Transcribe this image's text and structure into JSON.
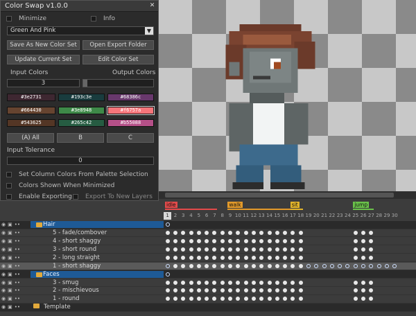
{
  "panel": {
    "title": "Color Swap v1.0.0",
    "minimize_label": "Minimize",
    "info_label": "Info",
    "preset_selected": "Green And Pink",
    "buttons": {
      "save_new": "Save As New Color Set",
      "open_export": "Open Export Folder",
      "update_current": "Update Current Set",
      "edit_color": "Edit Color Set"
    },
    "input_colors_label": "Input Colors",
    "output_colors_label": "Output Colors",
    "input_colors_value": "3",
    "swatches": [
      [
        {
          "hex": "#3e2731",
          "color": "#3e2731"
        },
        {
          "hex": "#193c3e",
          "color": "#193c3e"
        },
        {
          "hex": "#68386c",
          "color": "#68386c"
        }
      ],
      [
        {
          "hex": "#664430",
          "color": "#664430"
        },
        {
          "hex": "#3e8948",
          "color": "#3e8948"
        },
        {
          "hex": "#f6757a",
          "color": "#f6757a"
        }
      ],
      [
        {
          "hex": "#543625",
          "color": "#543625"
        },
        {
          "hex": "#265c42",
          "color": "#265c42"
        },
        {
          "hex": "#b55088",
          "color": "#b55088"
        }
      ]
    ],
    "col_buttons": [
      "(A) All",
      "B",
      "C"
    ],
    "tolerance_label": "Input Tolerance",
    "tolerance_value": "0",
    "chk_column": "Set Column Colors From Palette Selection",
    "chk_shown": "Colors Shown When Minimized",
    "chk_export": "Enable Exporting",
    "chk_new_layers": "Export To New Layers"
  },
  "timeline": {
    "tags": [
      {
        "name": "idle",
        "color": "#e34a4a"
      },
      {
        "name": "walk",
        "color": "#e39a2a"
      },
      {
        "name": "sit",
        "color": "#e3b52a"
      },
      {
        "name": "jump",
        "color": "#6ac24a"
      }
    ],
    "frames": [
      "1",
      "2",
      "3",
      "4",
      "5",
      "6",
      "7",
      "8",
      "9",
      "10",
      "11",
      "12",
      "13",
      "14",
      "15",
      "16",
      "17",
      "18",
      "19",
      "20",
      "21",
      "22",
      "23",
      "24",
      "25",
      "26",
      "27",
      "28",
      "29",
      "30"
    ],
    "layers": [
      {
        "name": "Hair",
        "type": "group"
      },
      {
        "name": "5 - fade/combover"
      },
      {
        "name": "4 - short shaggy"
      },
      {
        "name": "3 - short round"
      },
      {
        "name": "2 - long straight"
      },
      {
        "name": "1 - short shaggy",
        "active": true
      },
      {
        "name": "Faces",
        "type": "group"
      },
      {
        "name": "3 - smug"
      },
      {
        "name": "2 - mischievous"
      },
      {
        "name": "1 - round"
      },
      {
        "name": "Template",
        "type": "group-plain"
      }
    ]
  },
  "colors": {
    "group_highlight": "#1e5a96",
    "folder": "#e2a93b"
  }
}
